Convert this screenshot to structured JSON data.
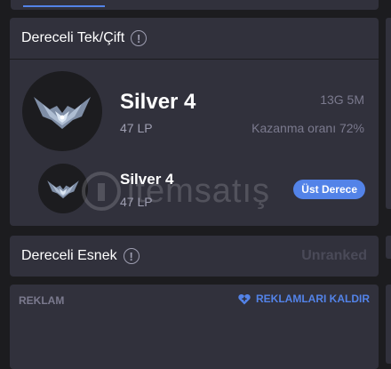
{
  "solo_queue": {
    "title": "Dereceli Tek/Çift",
    "tier": "Silver 4",
    "lp": "47 LP",
    "games": "13G 5M",
    "win_rate": "Kazanma oranı 72%",
    "peak": {
      "tier": "Silver 4",
      "lp": "47 LP",
      "badge": "Üst Derece"
    }
  },
  "flex_queue": {
    "title": "Dereceli Esnek",
    "status": "Unranked"
  },
  "ad": {
    "label": "REKLAM",
    "remove_label": "REKLAMLARI KALDIR"
  },
  "watermark": {
    "text": "itemsatış"
  },
  "colors": {
    "background": "#1c1c1f",
    "card": "#31313c",
    "accent": "#5383e8",
    "muted": "#7b7a8e"
  }
}
